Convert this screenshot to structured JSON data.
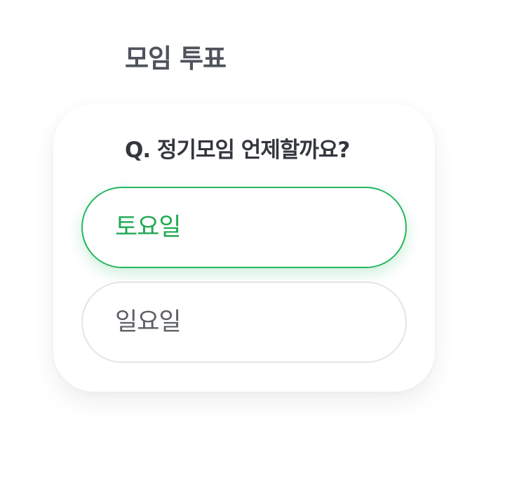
{
  "page": {
    "title": "모임 투표"
  },
  "poll": {
    "question": "Q. 정기모임 언제할까요?",
    "options": [
      {
        "label": "토요일",
        "selected": true
      },
      {
        "label": "일요일",
        "selected": false
      }
    ]
  },
  "colors": {
    "accent": "#26b65f",
    "accent_text": "#1faa52",
    "title_text": "#4f535c",
    "question_text": "#33363d",
    "option_text": "#5c5f66",
    "option_border": "#e3e4e6"
  }
}
